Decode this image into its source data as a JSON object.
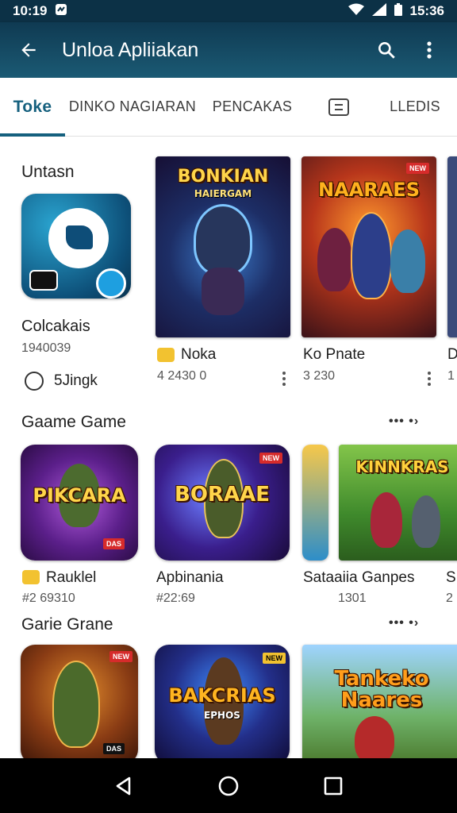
{
  "status": {
    "time": "10:19",
    "battery_text": "15:36"
  },
  "app_bar": {
    "title": "Unloa Apliiakan"
  },
  "tabs": [
    {
      "label": "Toke",
      "active": true
    },
    {
      "label": "DINKO NAGIARAN",
      "active": false
    },
    {
      "label": "PENCAKAS",
      "active": false
    },
    {
      "label": "",
      "icon": "box-tab-icon",
      "active": false
    },
    {
      "label": "LLEDIS",
      "active": false
    }
  ],
  "section1": {
    "title": "Untasn",
    "featured": {
      "name": "Colcakais",
      "meta": "1940039",
      "radio_label": "5Jingk"
    },
    "cards": [
      {
        "art_title": "BONKIAN",
        "art_sub": "HAIERGAM",
        "name": "Noka",
        "meta": "4 2430 0"
      },
      {
        "art_title": "NAARAES",
        "art_sub": "",
        "name": "Ko Pnate",
        "meta": "3 230"
      },
      {
        "art_title": "",
        "art_sub": "",
        "name": "D",
        "meta": "1"
      }
    ]
  },
  "section2": {
    "title": "Gaame Game",
    "more": "••• •›",
    "cards": [
      {
        "art_title": "PIKCARA",
        "name": "Rauklel",
        "meta": "#2 69310"
      },
      {
        "art_title": "BORAAE",
        "name": "Apbinania",
        "meta": "#22:69"
      },
      {
        "art_title": "",
        "name": "",
        "meta": ""
      },
      {
        "art_title": "KINNKRAS",
        "name": "Sataaiia Ganpes",
        "meta": "1301"
      },
      {
        "art_title": "",
        "name": "S",
        "meta": "2"
      }
    ]
  },
  "section3": {
    "title": "Garie Grane",
    "more": "••• •›",
    "cards": [
      {
        "art_title": "",
        "badge": "DAS"
      },
      {
        "art_title": "BAKCRIAS",
        "art_sub": "EPHOS"
      },
      {
        "art_title": "Tankeko Naares"
      }
    ]
  },
  "colors": {
    "status_bar": "#0c3146",
    "app_bar": "#1b5a74",
    "accent": "#15607e"
  },
  "icons": [
    "back-arrow-icon",
    "search-icon",
    "more-vert-icon",
    "wifi-icon",
    "signal-icon",
    "battery-icon",
    "back-nav-icon",
    "home-nav-icon",
    "recents-nav-icon"
  ]
}
